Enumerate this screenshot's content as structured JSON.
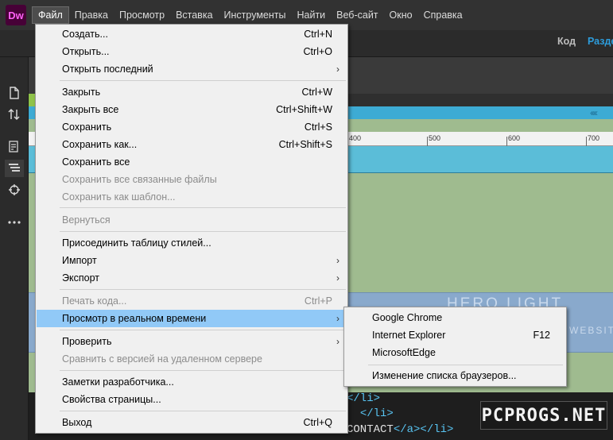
{
  "app": {
    "logo": "Dw"
  },
  "menubar": {
    "items": [
      "Файл",
      "Правка",
      "Просмотр",
      "Вставка",
      "Инструменты",
      "Найти",
      "Веб-сайт",
      "Окно",
      "Справка"
    ]
  },
  "view_switch": {
    "code": "Код",
    "split": "Разде"
  },
  "ruler": {
    "labels": [
      "400",
      "500",
      "600",
      "700"
    ]
  },
  "design": {
    "hero_title": "HERO LIGHT",
    "hero_sub": "WEBSIT"
  },
  "code": {
    "line1": "</li>",
    "line2": "</li>",
    "line3_text": "CONTACT",
    "line3_tags": "</a></li>"
  },
  "watermark": "PCPROGS.NET",
  "file_menu": {
    "new": {
      "label": "Создать...",
      "shortcut": "Ctrl+N"
    },
    "open": {
      "label": "Открыть...",
      "shortcut": "Ctrl+O"
    },
    "open_recent": {
      "label": "Открыть последний"
    },
    "close": {
      "label": "Закрыть",
      "shortcut": "Ctrl+W"
    },
    "close_all": {
      "label": "Закрыть все",
      "shortcut": "Ctrl+Shift+W"
    },
    "save": {
      "label": "Сохранить",
      "shortcut": "Ctrl+S"
    },
    "save_as": {
      "label": "Сохранить как...",
      "shortcut": "Ctrl+Shift+S"
    },
    "save_all": {
      "label": "Сохранить все"
    },
    "save_all_related": {
      "label": "Сохранить все связанные файлы"
    },
    "save_as_template": {
      "label": "Сохранить как шаблон..."
    },
    "revert": {
      "label": "Вернуться"
    },
    "attach_stylesheet": {
      "label": "Присоединить таблицу стилей..."
    },
    "import": {
      "label": "Импорт"
    },
    "export": {
      "label": "Экспорт"
    },
    "print_code": {
      "label": "Печать кода...",
      "shortcut": "Ctrl+P"
    },
    "realtime_preview": {
      "label": "Просмотр в реальном времени"
    },
    "validate": {
      "label": "Проверить"
    },
    "compare_remote": {
      "label": "Сравнить с версией на удаленном сервере"
    },
    "design_notes": {
      "label": "Заметки разработчика..."
    },
    "page_properties": {
      "label": "Свойства страницы..."
    },
    "exit": {
      "label": "Выход",
      "shortcut": "Ctrl+Q"
    }
  },
  "browser_submenu": {
    "chrome": {
      "label": "Google Chrome"
    },
    "ie": {
      "label": "Internet Explorer",
      "shortcut": "F12"
    },
    "edge": {
      "label": "MicrosoftEdge"
    },
    "edit_list": {
      "label": "Изменение списка браузеров..."
    }
  },
  "colors": {
    "menu_highlight": "#91c9f7",
    "menu_bg": "#f0f0f0",
    "accent_blue": "#2d9cdb",
    "logo_bg": "#470137",
    "logo_fg": "#ff61f6"
  }
}
